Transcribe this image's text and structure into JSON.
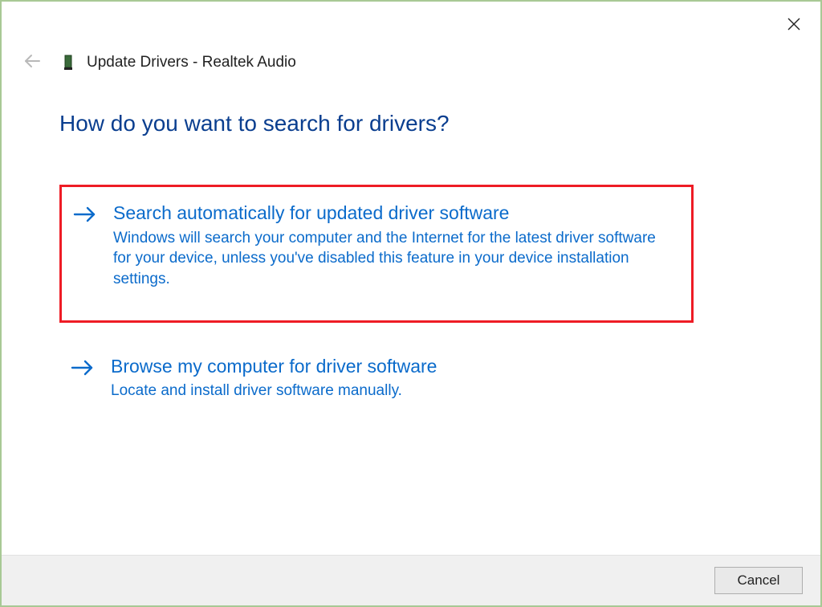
{
  "window": {
    "title": "Update Drivers - Realtek Audio"
  },
  "heading": "How do you want to search for drivers?",
  "options": [
    {
      "title": "Search automatically for updated driver software",
      "desc": "Windows will search your computer and the Internet for the latest driver software for your device, unless you've disabled this feature in your device installation settings."
    },
    {
      "title": "Browse my computer for driver software",
      "desc": "Locate and install driver software manually."
    }
  ],
  "footer": {
    "cancel_label": "Cancel"
  }
}
